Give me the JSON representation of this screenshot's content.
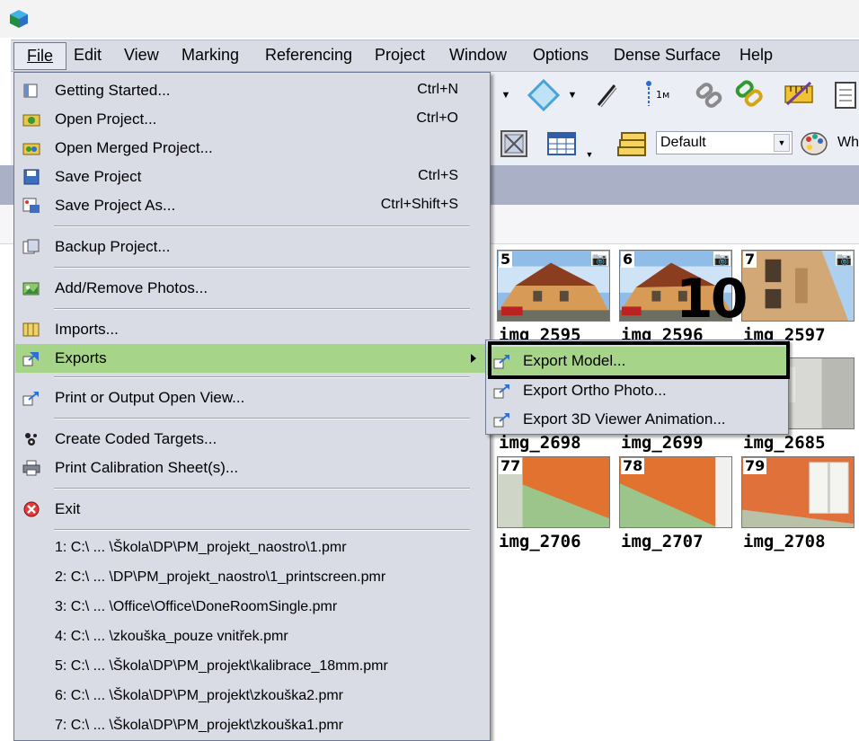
{
  "menubar": {
    "items": [
      "File",
      "Edit",
      "View",
      "Marking",
      "Referencing",
      "Project",
      "Window",
      "Options",
      "Dense Surface",
      "Help"
    ]
  },
  "toolbar": {
    "style_combo_value": "Default",
    "truncated_text": "Wh"
  },
  "file_menu": {
    "items": [
      {
        "label": "Getting Started...",
        "shortcut": "Ctrl+N",
        "icon": "getting-started-icon"
      },
      {
        "label": "Open Project...",
        "shortcut": "Ctrl+O",
        "icon": "open-project-icon"
      },
      {
        "label": "Open Merged Project...",
        "shortcut": "",
        "icon": "open-merged-project-icon"
      },
      {
        "label": "Save Project",
        "shortcut": "Ctrl+S",
        "icon": "save-icon"
      },
      {
        "label": "Save Project As...",
        "shortcut": "Ctrl+Shift+S",
        "icon": "save-as-icon"
      },
      {
        "label": "Backup Project...",
        "shortcut": "",
        "icon": "backup-icon"
      },
      {
        "label": "Add/Remove Photos...",
        "shortcut": "",
        "icon": "photos-icon"
      },
      {
        "label": "Imports...",
        "shortcut": "",
        "icon": "imports-icon"
      },
      {
        "label": "Exports",
        "shortcut": "",
        "icon": "exports-icon"
      },
      {
        "label": "Print or Output Open View...",
        "shortcut": "",
        "icon": "print-view-icon"
      },
      {
        "label": "Create Coded Targets...",
        "shortcut": "",
        "icon": "coded-targets-icon"
      },
      {
        "label": "Print Calibration Sheet(s)...",
        "shortcut": "",
        "icon": "printer-icon"
      },
      {
        "label": "Exit",
        "shortcut": "",
        "icon": "exit-icon"
      }
    ],
    "recent": [
      "1: C:\\ ... \\Škola\\DP\\PM_projekt_naostro\\1.pmr",
      "2: C:\\ ... \\DP\\PM_projekt_naostro\\1_printscreen.pmr",
      "3: C:\\ ... \\Office\\Office\\DoneRoomSingle.pmr",
      "4: C:\\ ... \\zkouška_pouze vnitřek.pmr",
      "5: C:\\ ... \\Škola\\DP\\PM_projekt\\kalibrace_18mm.pmr",
      "6: C:\\ ... \\Škola\\DP\\PM_projekt\\zkouška2.pmr",
      "7: C:\\ ... \\Škola\\DP\\PM_projekt\\zkouška1.pmr"
    ]
  },
  "exports_submenu": {
    "items": [
      {
        "label": "Export Model...",
        "icon": "export-model-icon"
      },
      {
        "label": "Export Ortho Photo...",
        "icon": "export-ortho-icon"
      },
      {
        "label": "Export 3D Viewer Animation...",
        "icon": "export-animation-icon"
      }
    ]
  },
  "photos": {
    "tiles": [
      {
        "number": "5",
        "name": "img_2595"
      },
      {
        "number": "6",
        "name": "img_2596"
      },
      {
        "number": "7",
        "name": "img_2597"
      },
      {
        "number": "",
        "name": "img_2698"
      },
      {
        "number": "",
        "name": "img_2699"
      },
      {
        "number": "",
        "name": "img_2685"
      },
      {
        "number": "77",
        "name": "img_2706"
      },
      {
        "number": "78",
        "name": "img_2707"
      },
      {
        "number": "79",
        "name": "img_2708"
      }
    ]
  },
  "annotation": {
    "step_number": "10"
  }
}
